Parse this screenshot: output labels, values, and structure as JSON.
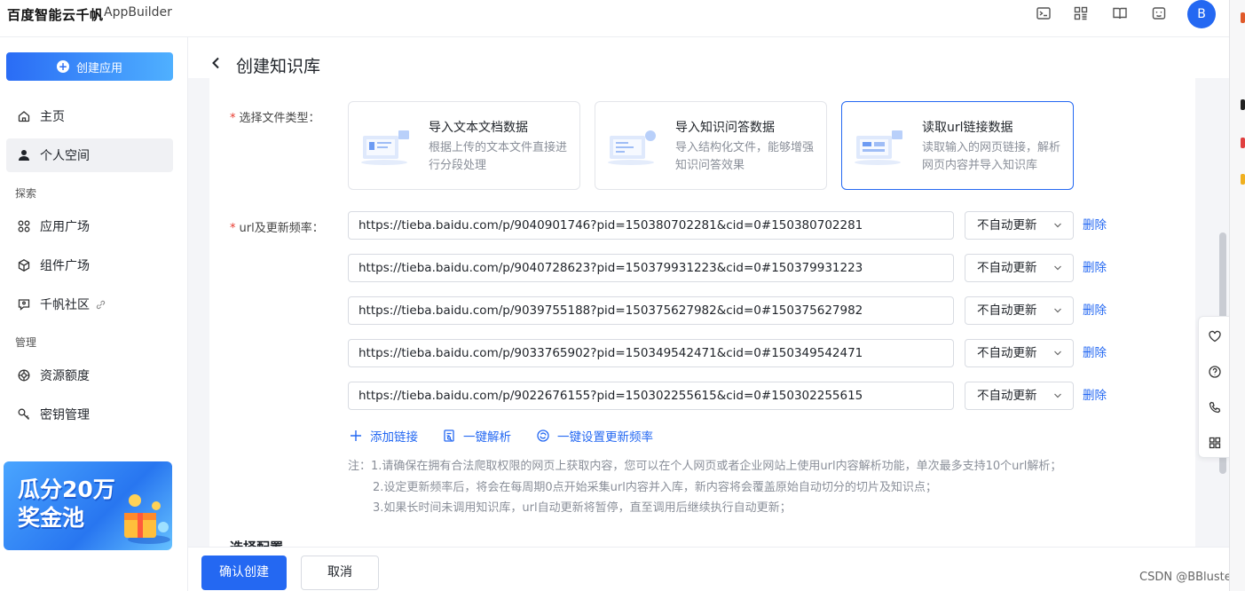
{
  "header": {
    "logo": "百度智能云千帆",
    "product": "AppBuilder",
    "icons": [
      "terminal-icon",
      "apps-icon",
      "book-icon",
      "robot-icon"
    ],
    "avatar": "B"
  },
  "sidebar": {
    "create_label": "创建应用",
    "items_top": [
      {
        "label": "主页",
        "icon": "home-icon"
      },
      {
        "label": "个人空间",
        "icon": "user-icon",
        "active": true
      }
    ],
    "section_explore": "探索",
    "items_explore": [
      {
        "label": "应用广场",
        "icon": "grid-icon"
      },
      {
        "label": "组件广场",
        "icon": "cube-icon"
      },
      {
        "label": "千帆社区",
        "icon": "community-icon"
      }
    ],
    "section_manage": "管理",
    "items_manage": [
      {
        "label": "资源额度",
        "icon": "quota-icon"
      },
      {
        "label": "密钥管理",
        "icon": "key-icon"
      }
    ],
    "banner_line1": "瓜分20万",
    "banner_line2": "奖金池"
  },
  "page": {
    "title": "创建知识库",
    "file_type_label": "选择文件类型：",
    "url_label": "url及更新频率：",
    "file_types": [
      {
        "title": "导入文本文档数据",
        "desc": "根据上传的文本文件直接进行分段处理"
      },
      {
        "title": "导入知识问答数据",
        "desc": "导入结构化文件，能够增强知识问答效果"
      },
      {
        "title": "读取url链接数据",
        "desc": "读取输入的网页链接，解析网页内容并导入知识库",
        "selected": true
      }
    ],
    "urls": [
      {
        "url": "https://tieba.baidu.com/p/9040901746?pid=150380702281&cid=0#150380702281",
        "freq": "不自动更新",
        "delete": "删除"
      },
      {
        "url": "https://tieba.baidu.com/p/9040728623?pid=150379931223&cid=0#150379931223",
        "freq": "不自动更新",
        "delete": "删除"
      },
      {
        "url": "https://tieba.baidu.com/p/9039755188?pid=150375627982&cid=0#150375627982",
        "freq": "不自动更新",
        "delete": "删除"
      },
      {
        "url": "https://tieba.baidu.com/p/9033765902?pid=150349542471&cid=0#150349542471",
        "freq": "不自动更新",
        "delete": "删除"
      },
      {
        "url": "https://tieba.baidu.com/p/9022676155?pid=150302255615&cid=0#150302255615",
        "freq": "不自动更新",
        "delete": "删除"
      }
    ],
    "actions": {
      "add_link": "添加链接",
      "parse_all": "一键解析",
      "set_freq_all": "一键设置更新频率"
    },
    "notes": [
      "注：1.请确保在拥有合法爬取权限的网页上获取内容，您可以在个人网页或者企业网站上使用url内容解析功能，单次最多支持10个url解析；",
      "2.设定更新频率后，将会在每周期0点开始采集url内容并入库，新内容将会覆盖原始自动切分的切片及知识点；",
      "3.如果长时间未调用知识库，url自动更新将暂停，直至调用后继续执行自动更新；"
    ],
    "next_section": "选择配置"
  },
  "footer": {
    "confirm": "确认创建",
    "cancel": "取消",
    "watermark": "CSDN @BBluster"
  },
  "colors": {
    "accent": "#2468f2",
    "required": "#e8392e",
    "muted_text": "#8a8f99"
  }
}
